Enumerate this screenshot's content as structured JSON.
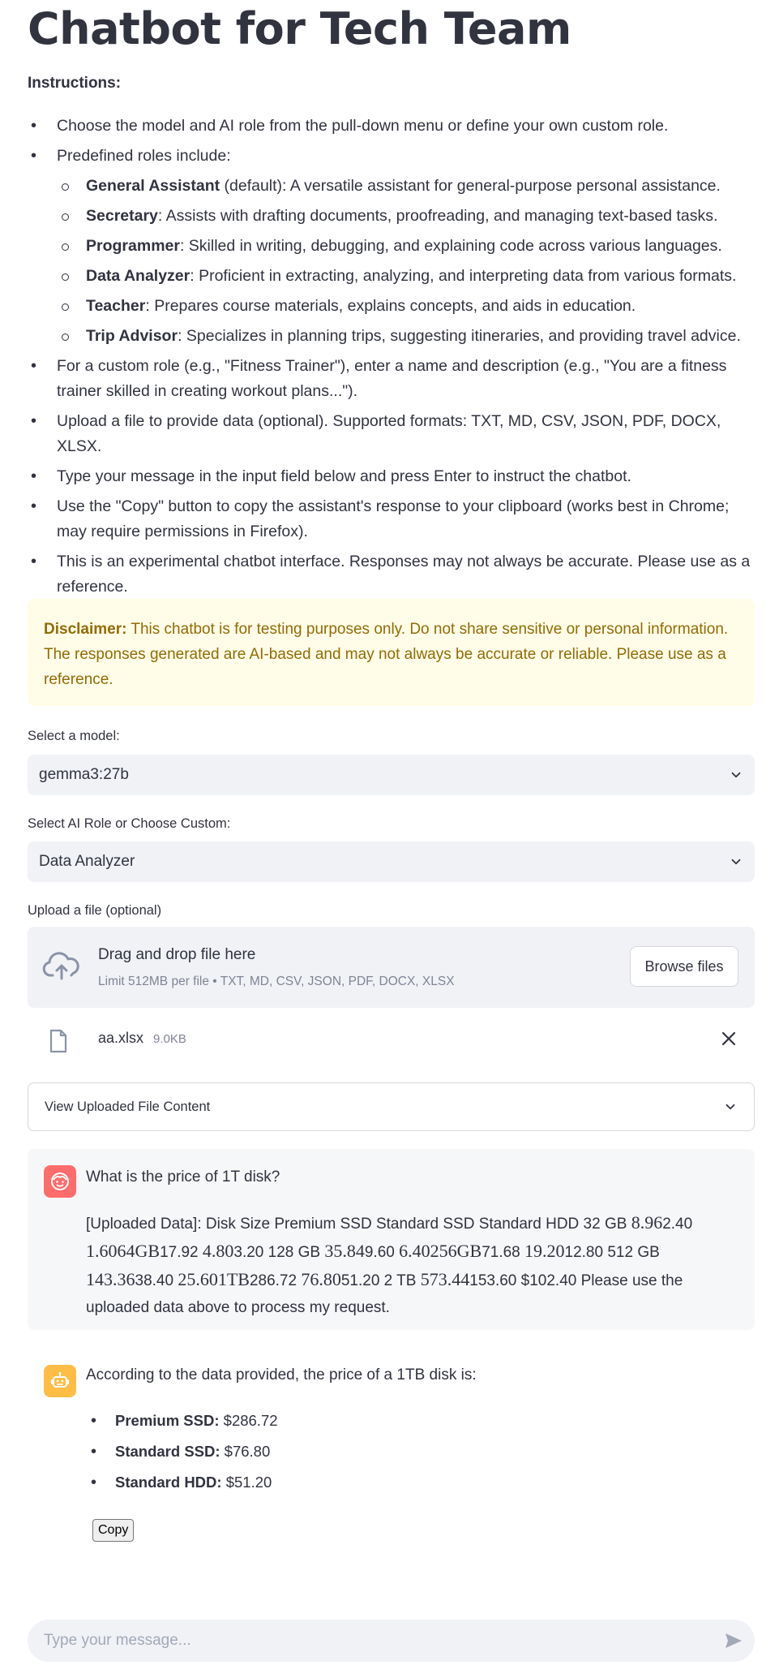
{
  "title": "Chatbot for Tech Team",
  "instructions": {
    "heading": "Instructions:",
    "item1": "Choose the model and AI role from the pull-down menu or define your own custom role.",
    "item2": "Predefined roles include:",
    "roles": [
      {
        "name": "General Assistant",
        "suffix": " (default)",
        "desc": ": A versatile assistant for general-purpose personal assistance."
      },
      {
        "name": "Secretary",
        "suffix": "",
        "desc": ": Assists with drafting documents, proofreading, and managing text-based tasks."
      },
      {
        "name": "Programmer",
        "suffix": "",
        "desc": ": Skilled in writing, debugging, and explaining code across various languages."
      },
      {
        "name": "Data Analyzer",
        "suffix": "",
        "desc": ": Proficient in extracting, analyzing, and interpreting data from various formats."
      },
      {
        "name": "Teacher",
        "suffix": "",
        "desc": ": Prepares course materials, explains concepts, and aids in education."
      },
      {
        "name": "Trip Advisor",
        "suffix": "",
        "desc": ": Specializes in planning trips, suggesting itineraries, and providing travel advice."
      }
    ],
    "item3": "For a custom role (e.g., \"Fitness Trainer\"), enter a name and description (e.g., \"You are a fitness trainer skilled in creating workout plans...\").",
    "item4": "Upload a file to provide data (optional). Supported formats: TXT, MD, CSV, JSON, PDF, DOCX, XLSX.",
    "item5": "Type your message in the input field below and press Enter to instruct the chatbot.",
    "item6": "Use the \"Copy\" button to copy the assistant's response to your clipboard (works best in Chrome; may require permissions in Firefox).",
    "item7": "This is an experimental chatbot interface. Responses may not always be accurate. Please use as a reference."
  },
  "disclaimer": {
    "label": "Disclaimer:",
    "text": " This chatbot is for testing purposes only. Do not share sensitive or personal information. The responses generated are AI-based and may not always be accurate or reliable. Please use as a reference."
  },
  "model": {
    "label": "Select a model:",
    "value": "gemma3:27b"
  },
  "role": {
    "label": "Select AI Role or Choose Custom:",
    "value": "Data Analyzer"
  },
  "upload": {
    "label": "Upload a file (optional)",
    "drag_text": "Drag and drop file here",
    "limit_text": "Limit 512MB per file • TXT, MD, CSV, JSON, PDF, DOCX, XLSX",
    "browse_label": "Browse files",
    "file_name": "aa.xlsx",
    "file_size": "9.0KB"
  },
  "expander_label": "View Uploaded File Content",
  "user_message": {
    "question": "What is the price of 1T disk?",
    "d1": "[Uploaded Data]: Disk Size Premium SSD Standard SSD Standard HDD 32 GB ",
    "m1": "8.96",
    "d2": "2.40",
    "m2": "1.6064GB",
    "d3": "17.92 ",
    "m3": "4.80",
    "d4": "3.20 128 GB ",
    "m4": "35.84",
    "d5": "9.60 ",
    "m5": "6.40256GB",
    "d6": "71.68 ",
    "m6": "19.20",
    "d7": "12.80 512 GB",
    "m7": "143.36",
    "d8": "38.40 ",
    "m8": "25.601TB",
    "d9": "286.72 ",
    "m9": "76.80",
    "d10": "51.20 2 TB ",
    "m10": "573.44",
    "d11": "153.60 $102.40 Please use the uploaded data above to process my request."
  },
  "assistant_message": {
    "intro": "According to the data provided, the price of a 1TB disk is:",
    "items": [
      {
        "label": "Premium SSD:",
        "value": " $286.72"
      },
      {
        "label": "Standard SSD:",
        "value": " $76.80"
      },
      {
        "label": "Standard HDD:",
        "value": " $51.20"
      }
    ],
    "copy_label": "Copy"
  },
  "chat_input": {
    "placeholder": "Type your message..."
  },
  "colors": {
    "user_avatar": "#ff6c6c",
    "bot_avatar": "#ffbd45",
    "disclaimer_bg": "#fffce7",
    "disclaimer_text": "#926c05"
  }
}
